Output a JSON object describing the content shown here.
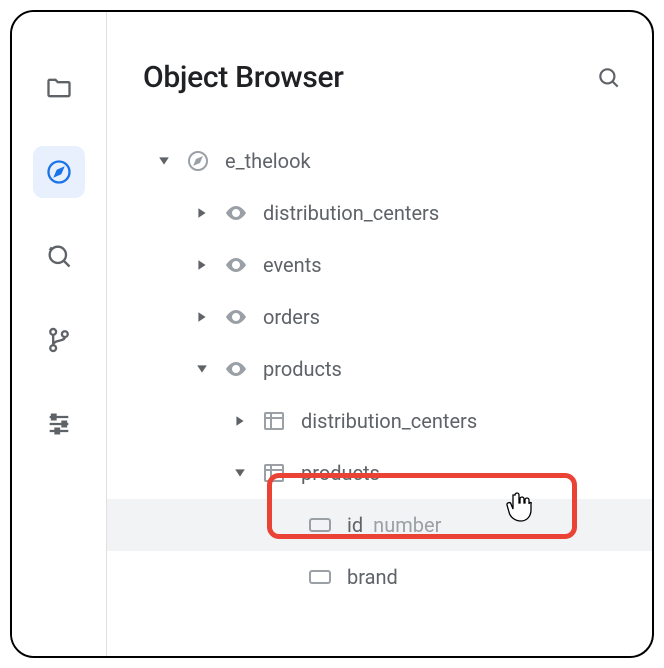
{
  "header": {
    "title": "Object Browser"
  },
  "tree": {
    "root": {
      "label": "e_thelook",
      "children": {
        "dc": {
          "label": "distribution_centers"
        },
        "events": {
          "label": "events"
        },
        "orders": {
          "label": "orders"
        },
        "products": {
          "label": "products",
          "children": {
            "dc": {
              "label": "distribution_centers"
            },
            "products": {
              "label": "products",
              "fields": {
                "id": {
                  "label": "id",
                  "type": "number"
                },
                "brand": {
                  "label": "brand"
                }
              }
            }
          }
        }
      }
    }
  }
}
